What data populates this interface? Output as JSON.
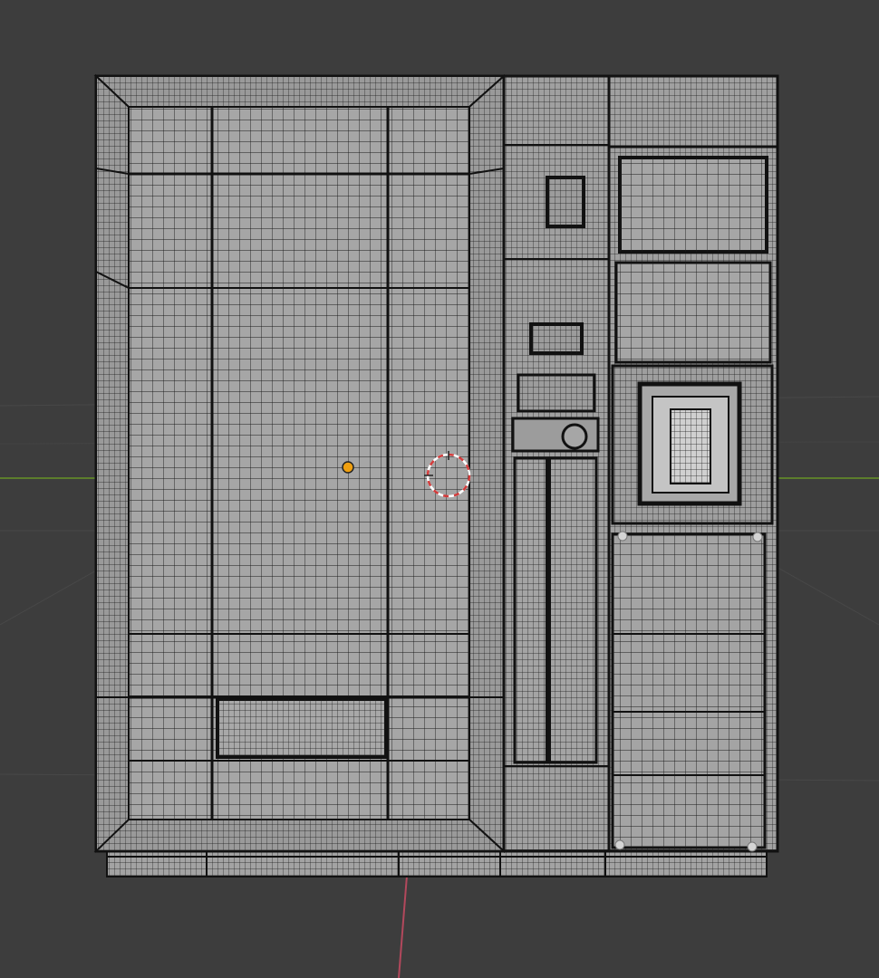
{
  "viewport": {
    "editor": "3D Viewport",
    "display_mode": "wireframe-overlay",
    "background_color": "#3d3d3d",
    "grid_color": "#4a4a4a",
    "x_axis_color": "#5c7d2c",
    "z_axis_color": "#b2485c",
    "mesh_face_color": "#a0a0a0",
    "mesh_edge_color": "#111111",
    "origin_color": "#f0a010",
    "cursor_colors": [
      "#d23b3b",
      "#ffffff"
    ]
  },
  "scene": {
    "object": {
      "type": "mesh",
      "description_icon": "mesh-object-icon",
      "parts": [
        "left-door-panel",
        "middle-column",
        "right-column",
        "base-plinth"
      ]
    },
    "selected_vertices": 4
  }
}
